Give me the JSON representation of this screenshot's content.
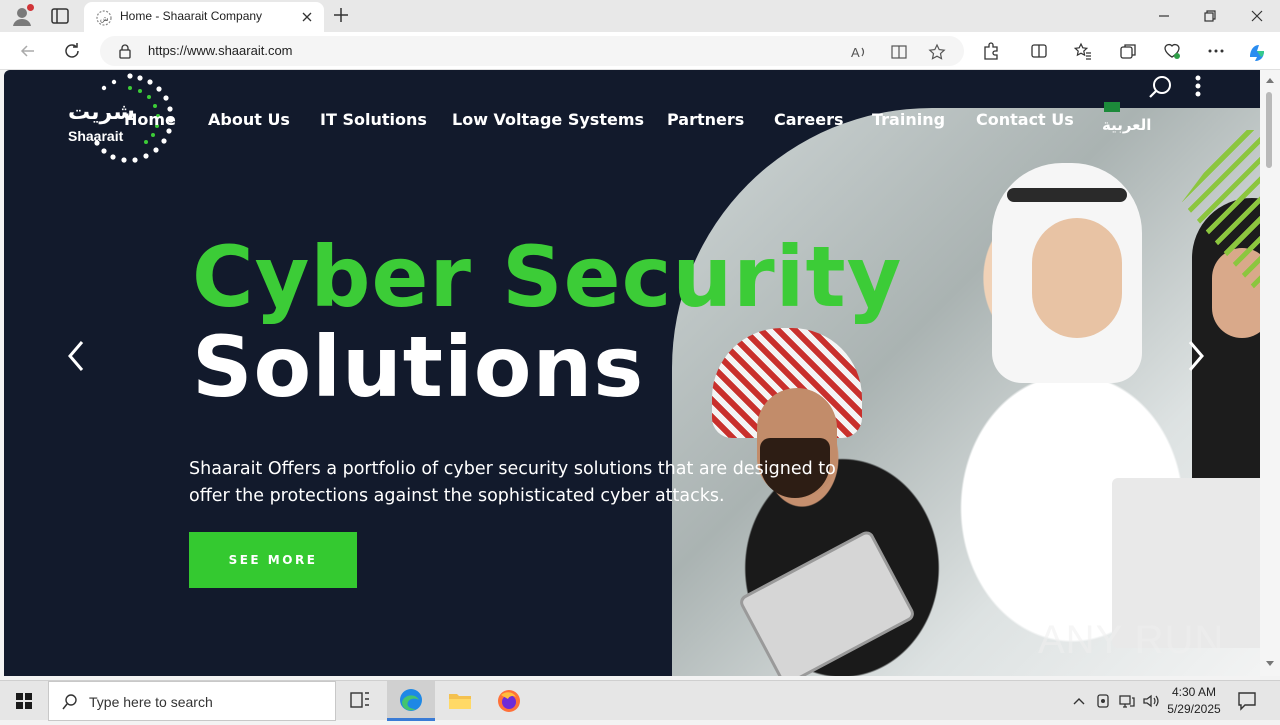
{
  "browser": {
    "tab_title": "Home - Shaarait Company",
    "url": "https://www.shaarait.com"
  },
  "site": {
    "logo_arabic": "شريت",
    "logo_english": "Shaarait",
    "nav": [
      "Home",
      "About Us",
      "IT Solutions",
      "Low Voltage Systems",
      "Partners",
      "Careers",
      "Training",
      "Contact Us"
    ],
    "language_label": "العربية",
    "hero": {
      "title_line1": "Cyber Security",
      "title_line2": "Solutions",
      "description": "Shaarait Offers a portfolio of cyber security solutions that are designed to offer the protections against the sophisticated cyber attacks.",
      "cta_label": "SEE MORE"
    },
    "colors": {
      "accent_green": "#3ccc37",
      "background": "#121a2c"
    }
  },
  "watermark": "ANY RUN",
  "taskbar": {
    "search_placeholder": "Type here to search",
    "time": "4:30 AM",
    "date": "5/29/2025"
  }
}
